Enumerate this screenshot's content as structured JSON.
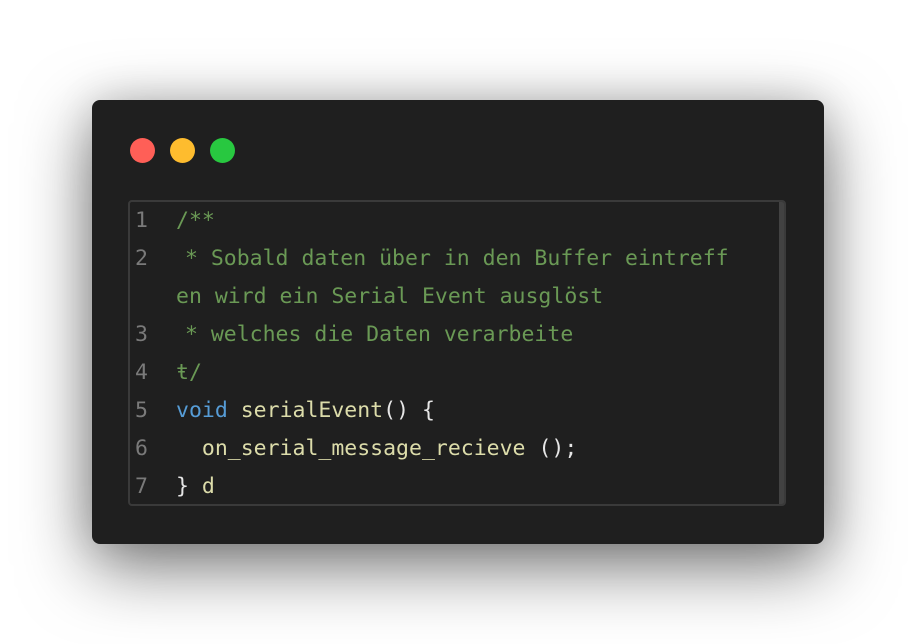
{
  "window": {
    "colors": {
      "background": "#1f1f1f",
      "close": "#ff5f57",
      "minimize": "#febc2e",
      "maximize": "#28c840"
    }
  },
  "editor": {
    "lines": [
      {
        "number": "1",
        "tokens": [
          {
            "type": "comment",
            "text": "/**"
          }
        ]
      },
      {
        "number": "2",
        "tokens": [
          {
            "type": "comment",
            "text": " * Sobald daten über in den Buffer eintreff"
          }
        ]
      },
      {
        "number": "",
        "tokens": [
          {
            "type": "comment",
            "text": "en wird ein Serial Event ausglöst"
          }
        ]
      },
      {
        "number": "3",
        "tokens": [
          {
            "type": "comment",
            "text": " * welches die Daten verarbeite"
          }
        ]
      },
      {
        "number": "4",
        "tokens": [
          {
            "type": "comment",
            "text": "ŧ/"
          }
        ]
      },
      {
        "number": "5",
        "tokens": [
          {
            "type": "keyword",
            "text": "void"
          },
          {
            "type": "plain",
            "text": " "
          },
          {
            "type": "function",
            "text": "serialEvent"
          },
          {
            "type": "plain",
            "text": "() {"
          }
        ]
      },
      {
        "number": "6",
        "tokens": [
          {
            "type": "plain",
            "text": "  "
          },
          {
            "type": "function",
            "text": "on_serial_message_recieve"
          },
          {
            "type": "plain",
            "text": " ();"
          }
        ]
      },
      {
        "number": "7",
        "tokens": [
          {
            "type": "plain",
            "text": "} "
          },
          {
            "type": "function",
            "text": "d"
          }
        ]
      }
    ],
    "colors": {
      "comment": "#6a9955",
      "keyword": "#569cd6",
      "function": "#dcdcaa",
      "plain": "#e6e6e6",
      "line_number": "#7a7a7a"
    }
  }
}
